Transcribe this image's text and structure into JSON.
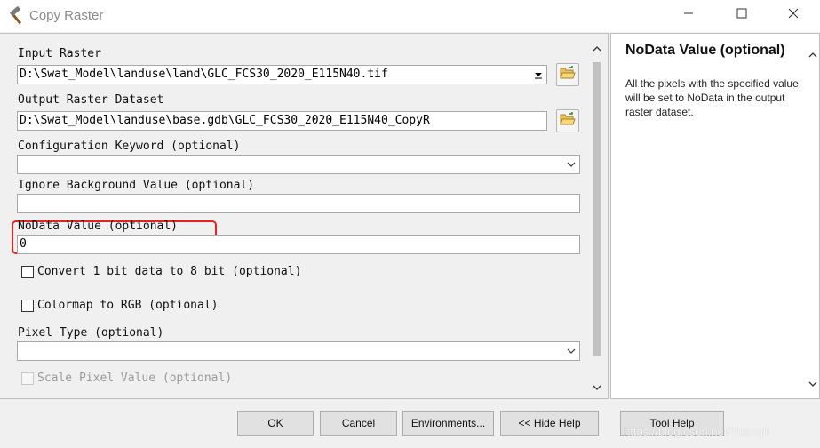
{
  "window": {
    "title": "Copy Raster",
    "minimize_icon": "minimize-icon",
    "maximize_icon": "maximize-icon",
    "close_icon": "close-icon",
    "app_icon": "hammer-icon"
  },
  "params": {
    "input_raster": {
      "label": "Input Raster",
      "value": "D:\\Swat_Model\\landuse\\land\\GLC_FCS30_2020_E115N40.tif"
    },
    "output_raster": {
      "label": "Output Raster Dataset",
      "value": "D:\\Swat_Model\\landuse\\base.gdb\\GLC_FCS30_2020_E115N40_CopyR"
    },
    "config_keyword": {
      "label": "Configuration Keyword (optional)",
      "value": ""
    },
    "ignore_background": {
      "label": "Ignore Background Value (optional)",
      "value": ""
    },
    "nodata": {
      "label": "NoData Value (optional)",
      "value": "0"
    },
    "convert_1bit": {
      "label": "Convert 1 bit data to 8 bit (optional)",
      "checked": false
    },
    "colormap_rgb": {
      "label": "Colormap to RGB (optional)",
      "checked": false
    },
    "pixel_type": {
      "label": "Pixel Type (optional)",
      "value": ""
    },
    "scale_pixel": {
      "label": "Scale Pixel Value (optional)",
      "checked": false,
      "disabled": true
    }
  },
  "help": {
    "title": "NoData Value (optional)",
    "text": "All the pixels with the specified value will be set to NoData in the output raster dataset."
  },
  "buttons": {
    "ok": "OK",
    "cancel": "Cancel",
    "environments": "Environments...",
    "hide_help": "<< Hide Help",
    "tool_help": "Tool Help"
  },
  "watermark": "https://blog.csdn.net/Yuanqh",
  "colors": {
    "highlight": "#e8231f",
    "window_bg": "#f0f0f0",
    "help_bg": "#ffffff"
  }
}
